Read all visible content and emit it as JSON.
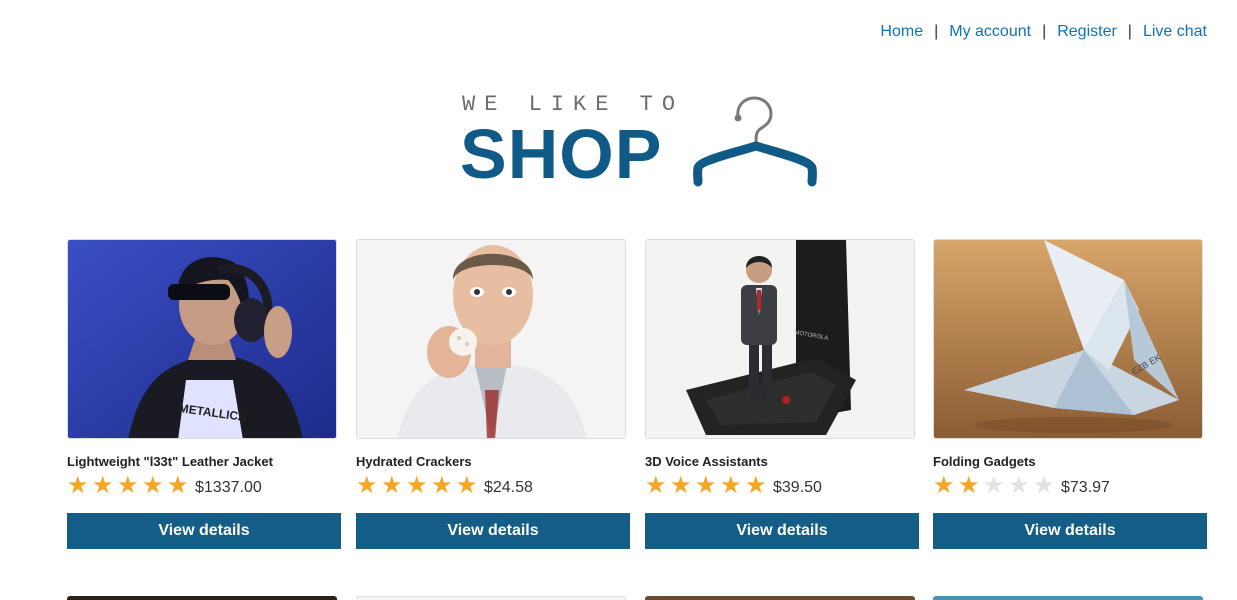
{
  "nav": {
    "items": [
      "Home",
      "My account",
      "Register",
      "Live chat"
    ],
    "separator": "|"
  },
  "logo": {
    "tagline": "WE LIKE TO",
    "word": "SHOP",
    "icon": "hanger-icon"
  },
  "colors": {
    "link": "#0e73b8",
    "brand": "#0f5a86",
    "button": "#135d86",
    "star_on": "#f5a623",
    "star_off": "#e2e2e2"
  },
  "products": [
    {
      "name": "Lightweight \"l33t\" Leather Jacket",
      "rating": 5,
      "price": "$1337.00",
      "button": "View details",
      "image": "woman-headphones-photo"
    },
    {
      "name": "Hydrated Crackers",
      "rating": 5,
      "price": "$24.58",
      "button": "View details",
      "image": "man-eating-cracker-photo"
    },
    {
      "name": "3D Voice Assistants",
      "rating": 5,
      "price": "$39.50",
      "button": "View details",
      "image": "figurine-on-phone-photo"
    },
    {
      "name": "Folding Gadgets",
      "rating": 2,
      "price": "$73.97",
      "button": "View details",
      "image": "origami-bird-photo"
    }
  ]
}
